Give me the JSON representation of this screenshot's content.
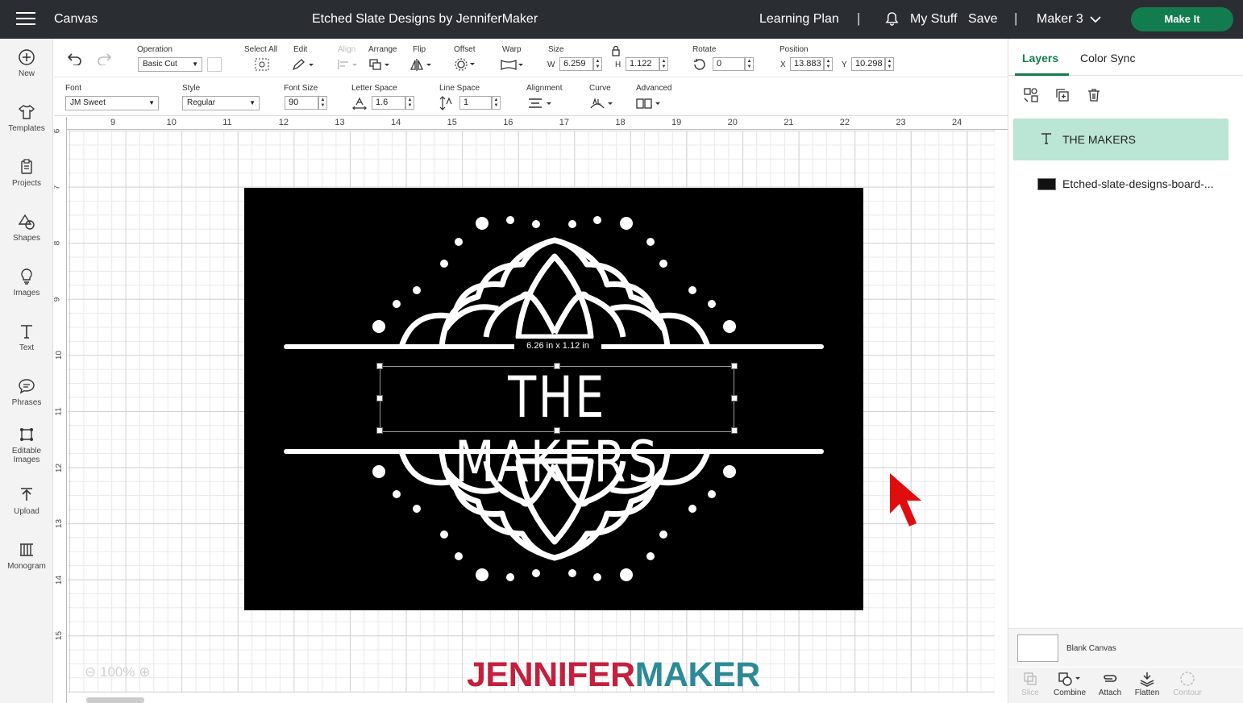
{
  "topbar": {
    "app_title": "Canvas",
    "project_name": "Etched Slate Designs by JenniferMaker",
    "learning_plan": "Learning Plan",
    "separator": "|",
    "my_stuff": "My Stuff",
    "save": "Save",
    "machine": "Maker 3",
    "make_it": "Make It"
  },
  "left_nav": [
    "New",
    "Templates",
    "Projects",
    "Shapes",
    "Images",
    "Text",
    "Phrases",
    "Editable Images",
    "Upload",
    "Monogram"
  ],
  "toolbar1": {
    "operation_label": "Operation",
    "operation_value": "Basic Cut",
    "select_all": "Select All",
    "edit": "Edit",
    "align": "Align",
    "arrange": "Arrange",
    "flip": "Flip",
    "offset": "Offset",
    "warp": "Warp",
    "size_label": "Size",
    "w_label": "W",
    "w_value": "6.259",
    "h_label": "H",
    "h_value": "1.122",
    "rotate_label": "Rotate",
    "rotate_value": "0",
    "position_label": "Position",
    "x_label": "X",
    "x_value": "13.883",
    "y_label": "Y",
    "y_value": "10.298"
  },
  "toolbar2": {
    "font_label": "Font",
    "font_value": "JM Sweet",
    "style_label": "Style",
    "style_value": "Regular",
    "font_size_label": "Font Size",
    "font_size_value": "90",
    "letter_space_label": "Letter Space",
    "letter_space_value": "1.6",
    "line_space_label": "Line Space",
    "line_space_value": "1",
    "alignment_label": "Alignment",
    "curve_label": "Curve",
    "advanced_label": "Advanced"
  },
  "canvas": {
    "ruler_top": [
      "9",
      "10",
      "11",
      "12",
      "13",
      "14",
      "15",
      "16",
      "17",
      "18",
      "19",
      "20",
      "21",
      "22",
      "23",
      "24"
    ],
    "ruler_left": [
      "6",
      "7",
      "8",
      "9",
      "10",
      "11",
      "12",
      "13",
      "14",
      "15"
    ],
    "dimension_tooltip": "6.26  in x 1.12  in",
    "design_text": "THE MAKERS",
    "zoom": "100%",
    "brand_part1": "JENNIFER",
    "brand_part2": "MAKER"
  },
  "right_panel": {
    "tab_layers": "Layers",
    "tab_color_sync": "Color Sync",
    "layers": [
      "THE MAKERS",
      "Etched-slate-designs-board-..."
    ],
    "blank_canvas": "Blank Canvas",
    "bottom_tools": [
      "Slice",
      "Combine",
      "Attach",
      "Flatten",
      "Contour"
    ]
  },
  "colors": {
    "topbar_bg": "#2a2d32",
    "make_it_green": "#137c4e",
    "layer_highlight": "#bbe5d4",
    "brand_red": "#c41f3c",
    "brand_teal": "#2c8a96"
  }
}
